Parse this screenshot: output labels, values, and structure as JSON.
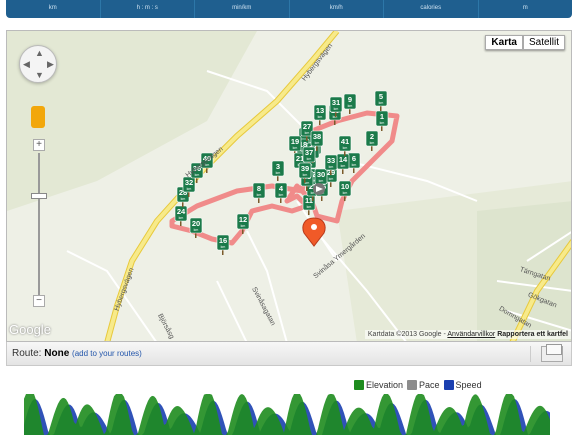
{
  "stats_strip": {
    "units": [
      "km",
      "h : m : s",
      "min/km",
      "km/h",
      "calories",
      "m"
    ]
  },
  "map": {
    "type_buttons": {
      "map": "Karta",
      "satellite": "Satellit"
    },
    "road_labels": {
      "hyberg_top": "Hybergsvägen",
      "hyberg_left": "Hybergsvägen",
      "hyberg_bottom": "Hybergsvägen",
      "svinasa_ymer": "Svinåsa Ymergården",
      "svinasagatan": "Svinåsagatan",
      "bjorsas": "Björsåsg",
      "tarngatan": "Tärngatan",
      "gokgatan": "Gökgatan",
      "domngatan": "Domngatan"
    },
    "google_logo": "Google",
    "attribution": "Kartdata ©2013 Google -",
    "terms_link": "Användarvillkor",
    "report_link": "Rapportera ett kartfel",
    "km_markers": [
      "1",
      "2",
      "3",
      "4",
      "5",
      "6",
      "7",
      "8",
      "9",
      "10",
      "11",
      "12",
      "13",
      "14",
      "15",
      "16",
      "17",
      "18",
      "19",
      "20",
      "21",
      "22",
      "23",
      "24",
      "25",
      "26",
      "27",
      "28",
      "29",
      "30",
      "31",
      "32",
      "33",
      "34",
      "35",
      "36",
      "37",
      "38",
      "39",
      "40",
      "41"
    ],
    "marker_unit": "km"
  },
  "route_bar": {
    "label": "Route:",
    "value": "None",
    "add_link": "(add to your routes)"
  },
  "chart_legend": [
    {
      "name": "Elevation",
      "color": "#1e8c1e"
    },
    {
      "name": "Pace",
      "color": "#8c8c8c"
    },
    {
      "name": "Speed",
      "color": "#1a3fb0"
    }
  ],
  "colors": {
    "route": "#f08080",
    "marker": "#1b7a4a",
    "pin": "#f05a28",
    "roads": "#f4e27a"
  }
}
